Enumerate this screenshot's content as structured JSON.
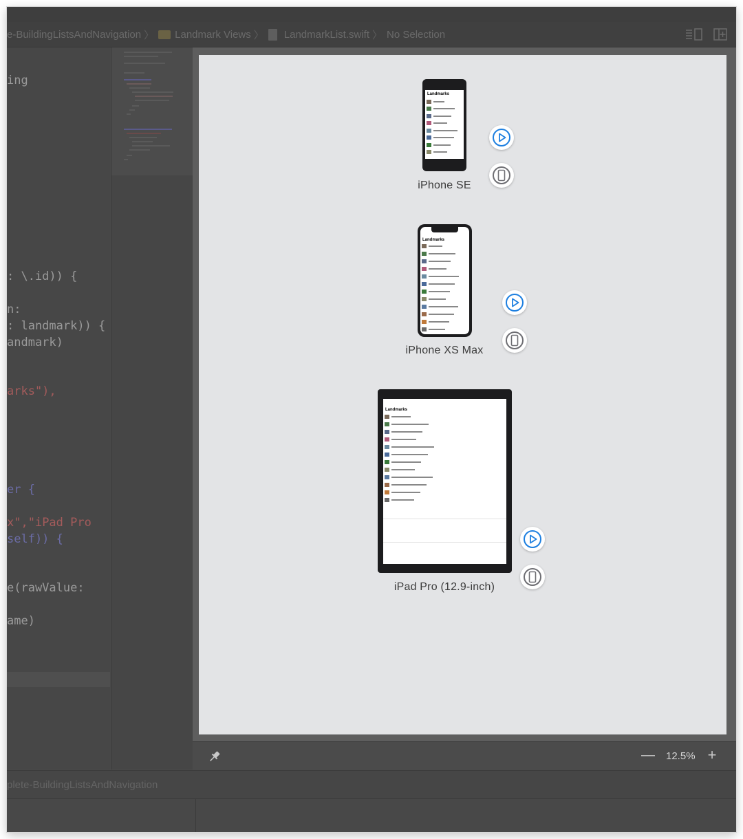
{
  "breadcrumb": {
    "project": "e-BuildingListsAndNavigation",
    "folder": "Landmark Views",
    "file": "LandmarkList.swift",
    "selection": "No Selection"
  },
  "code": {
    "line1": "ing",
    "line2": ": \\.id)) {",
    "line3": "n:",
    "line4": ": landmark)) {",
    "line5": "andmark)",
    "line6": "arks\"),",
    "line7": "er {",
    "line8a": "x\",",
    "line8b": "\"iPad Pro",
    "line9": "self)) {",
    "line10": "e(rawValue:",
    "line11": "ame)"
  },
  "previews": {
    "screen_title": "Landmarks",
    "devices": [
      {
        "name": "iPhone SE"
      },
      {
        "name": "iPhone XS Max"
      },
      {
        "name": "iPad Pro (12.9-inch)"
      }
    ]
  },
  "icons": {
    "live_preview": "play-circle-icon",
    "preview_on_device": "device-icon",
    "pin": "pin-icon",
    "zoom_out": "minus-icon",
    "zoom_in": "plus-icon"
  },
  "zoom": {
    "minus": "—",
    "value": "12.5%",
    "plus": "+"
  },
  "debug": {
    "scheme": "plete-BuildingListsAndNavigation"
  },
  "colors": {
    "accent": "#1d7fe0",
    "canvas": "#e3e4e6",
    "device_bezel": "#1c1c1e"
  }
}
